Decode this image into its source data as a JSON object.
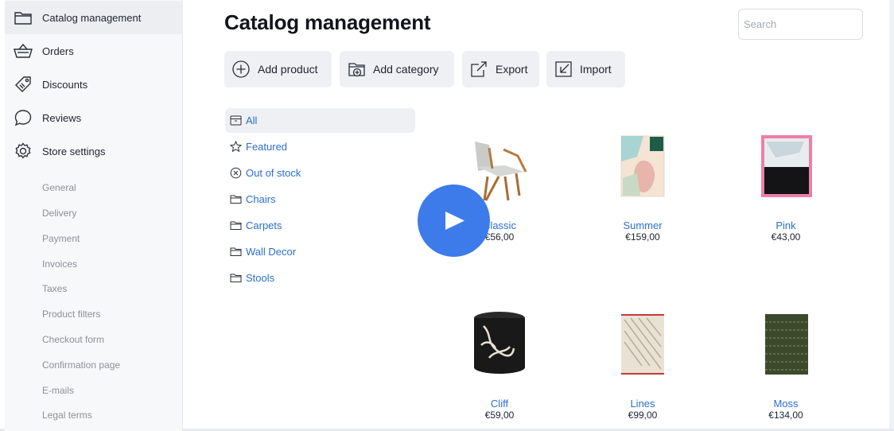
{
  "sidebar": {
    "items": [
      {
        "label": "Catalog management",
        "icon": "folder-icon"
      },
      {
        "label": "Orders",
        "icon": "basket-icon"
      },
      {
        "label": "Discounts",
        "icon": "tag-icon"
      },
      {
        "label": "Reviews",
        "icon": "chat-bubble-icon"
      },
      {
        "label": "Store settings",
        "icon": "gear-icon"
      }
    ],
    "sub_items": [
      "General",
      "Delivery",
      "Payment",
      "Invoices",
      "Taxes",
      "Product filters",
      "Checkout form",
      "Confirmation page",
      "E-mails",
      "Legal terms"
    ]
  },
  "main": {
    "title": "Catalog management",
    "search_placeholder": "Search",
    "toolbar": [
      {
        "label": "Add product",
        "icon": "plus-circle-icon"
      },
      {
        "label": "Add category",
        "icon": "add-folder-icon"
      },
      {
        "label": "Export",
        "icon": "export-icon"
      },
      {
        "label": "Import",
        "icon": "import-icon"
      }
    ],
    "categories": [
      {
        "label": "All",
        "icon": "archive-icon"
      },
      {
        "label": "Featured",
        "icon": "star-icon"
      },
      {
        "label": "Out of stock",
        "icon": "x-circle-icon"
      },
      {
        "label": "Chairs",
        "icon": "folder-icon"
      },
      {
        "label": "Carpets",
        "icon": "folder-icon"
      },
      {
        "label": "Wall Decor",
        "icon": "folder-icon"
      },
      {
        "label": "Stools",
        "icon": "folder-icon"
      }
    ],
    "products": [
      {
        "name": "Classic",
        "price": "€56,00"
      },
      {
        "name": "Summer",
        "price": "€159,00"
      },
      {
        "name": "Pink",
        "price": "€43,00"
      },
      {
        "name": "Cliff",
        "price": "€59,00"
      },
      {
        "name": "Lines",
        "price": "€99,00"
      },
      {
        "name": "Moss",
        "price": "€134,00"
      }
    ]
  },
  "overlay": {
    "icon": "play-icon"
  },
  "colors": {
    "accent": "#3d7bea",
    "link": "#2b6fd0",
    "sidebar_bg": "#f7f8fa",
    "button_bg": "#eef0f3"
  }
}
